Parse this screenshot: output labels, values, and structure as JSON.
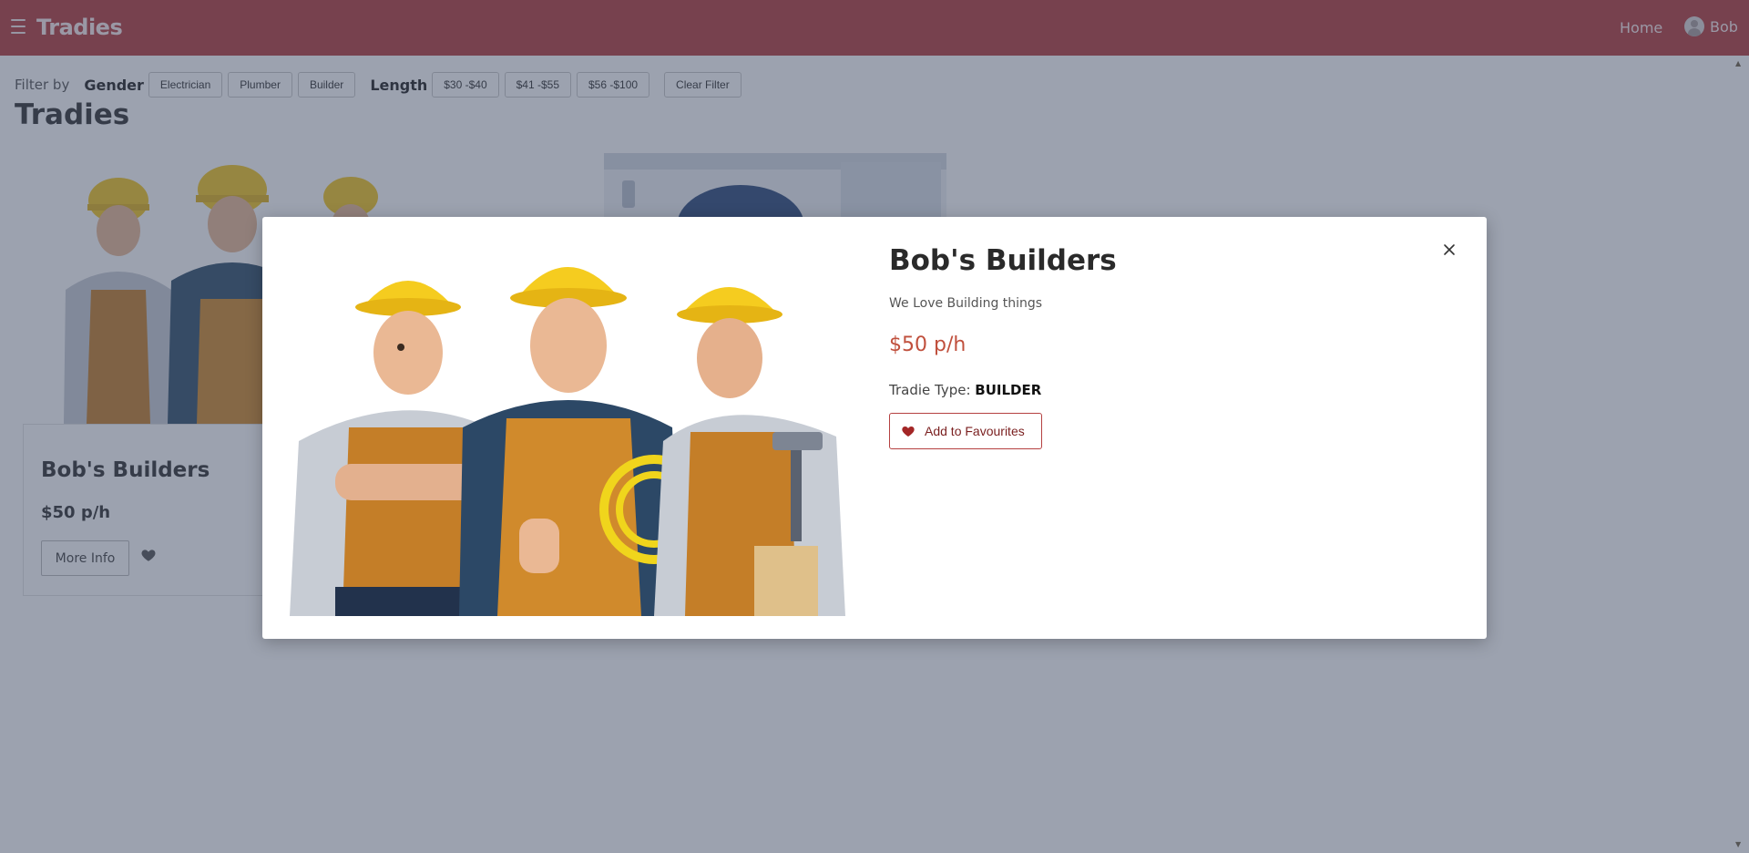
{
  "navbar": {
    "brand": "Tradies",
    "home_label": "Home",
    "user_name": "Bob",
    "background_color": "#b53c3c",
    "icons": {
      "menu": "hamburger-icon",
      "user": "user-avatar-icon"
    }
  },
  "filters": {
    "filter_by_label": "Filter by",
    "gender_label": "Gender",
    "gender_options": [
      "Electrician",
      "Plumber",
      "Builder"
    ],
    "length_label": "Length",
    "length_options": [
      "$30 -$40",
      "$41 -$55",
      "$56 -$100"
    ],
    "clear_label": "Clear Filter"
  },
  "page": {
    "title": "Tradies"
  },
  "cards": [
    {
      "title": "Bob's Builders",
      "price": "$50 p/h",
      "more_info_label": "More Info",
      "image": "three-builders-photo"
    },
    {
      "image": "plumber-photo"
    }
  ],
  "modal": {
    "title": "Bob's Builders",
    "description": "We Love Building things",
    "price": "$50 p/h",
    "tradie_type_label": "Tradie Type:",
    "tradie_type_value": "BUILDER",
    "favourite_label": "Add to Favourites",
    "price_color": "#c0503d",
    "image": "three-builders-photo",
    "icons": {
      "close": "close-icon",
      "favourite": "heart-icon"
    }
  }
}
